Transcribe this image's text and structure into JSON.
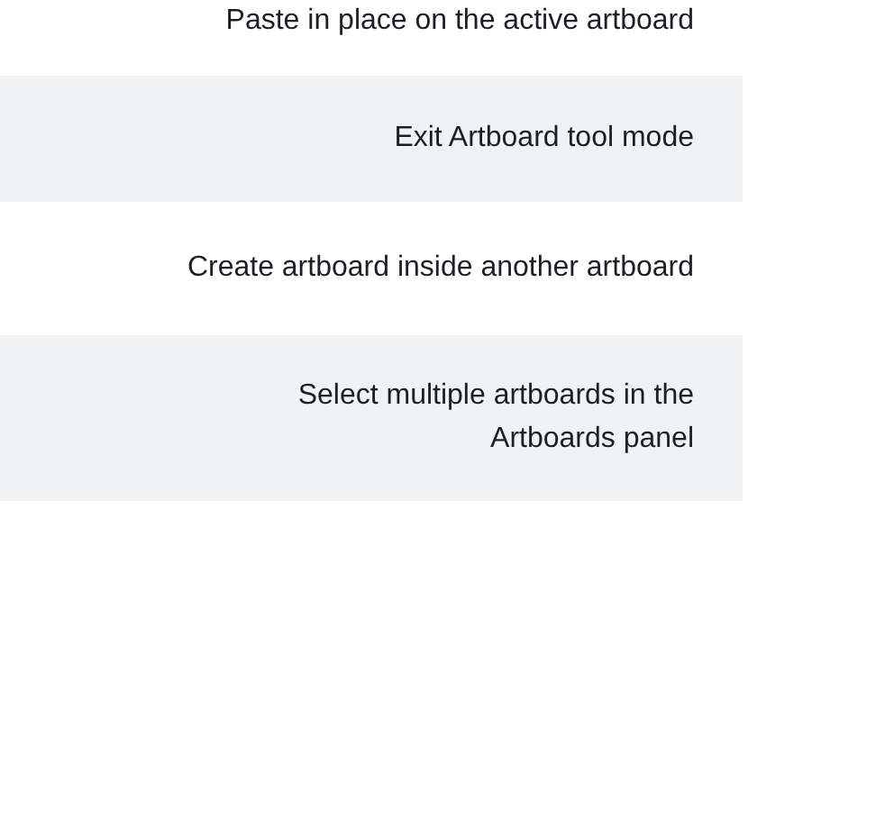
{
  "table": {
    "rows": [
      {
        "description": "Paste in place on the active artboard"
      },
      {
        "description": "Exit Artboard tool mode"
      },
      {
        "description": "Create artboard inside another artboard"
      },
      {
        "description": "Select multiple artboards in the Artboards panel"
      }
    ]
  }
}
